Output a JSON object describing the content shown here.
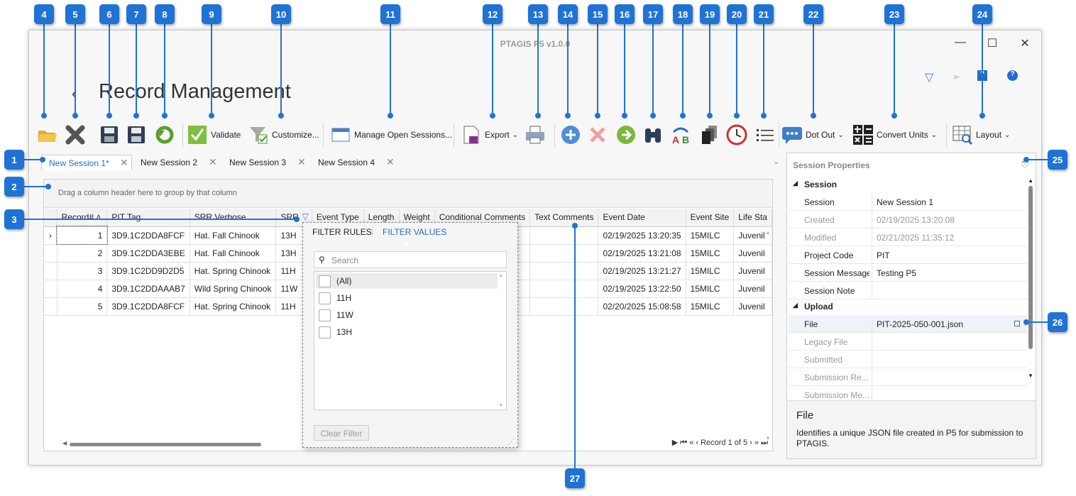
{
  "window": {
    "app_title": "PTAGIS P5 v1.0.0",
    "page_title": "Record Management",
    "min_icon": "minimize-icon",
    "max_icon": "maximize-icon",
    "close_icon": "close-icon"
  },
  "callouts": [
    "1",
    "2",
    "3",
    "4",
    "5",
    "6",
    "7",
    "8",
    "9",
    "10",
    "11",
    "12",
    "13",
    "14",
    "15",
    "16",
    "17",
    "18",
    "19",
    "20",
    "21",
    "22",
    "23",
    "24",
    "25",
    "26",
    "27"
  ],
  "toolbar": {
    "validate": "Validate",
    "customize": "Customize...",
    "manage_sessions": "Manage Open Sessions...",
    "export": "Export",
    "dot_out": "Dot Out",
    "convert_units": "Convert Units",
    "layout": "Layout"
  },
  "tabs": [
    {
      "label": "New Session 1*",
      "active": true
    },
    {
      "label": "New Session 2",
      "active": false
    },
    {
      "label": "New Session 3",
      "active": false
    },
    {
      "label": "New Session 4",
      "active": false
    }
  ],
  "grid": {
    "group_hint": "Drag a column header here to group by that column",
    "columns": [
      "Record#",
      "PIT Tag",
      "SRR Verbose",
      "SRR",
      "Event Type",
      "Length",
      "Weight",
      "Conditional Comments",
      "Text Comments",
      "Event Date",
      "Event Site",
      "Life Sta"
    ],
    "rows": [
      {
        "record": "1",
        "pit": "3D9.1C2DDA8FCF",
        "srr_verbose": "Hat. Fall Chinook",
        "srr": "13H",
        "date": "02/19/2025 13:20:35",
        "site": "15MILC",
        "life": "Juvenil"
      },
      {
        "record": "2",
        "pit": "3D9.1C2DDA3EBE",
        "srr_verbose": "Hat. Fall Chinook",
        "srr": "13H",
        "date": "02/19/2025 13:21:08",
        "site": "15MILC",
        "life": "Juvenil"
      },
      {
        "record": "3",
        "pit": "3D9.1C2DD9D2D5",
        "srr_verbose": "Hat. Spring Chinook",
        "srr": "11H",
        "date": "02/19/2025 13:21:27",
        "site": "15MILC",
        "life": "Juvenil"
      },
      {
        "record": "4",
        "pit": "3D9.1C2DDAAAB7",
        "srr_verbose": "Wild Spring Chinook",
        "srr": "11W",
        "date": "02/19/2025 13:22:50",
        "site": "15MILC",
        "life": "Juvenil"
      },
      {
        "record": "5",
        "pit": "3D9.1C2DDA8FCF",
        "srr_verbose": "Hat. Spring Chinook",
        "srr": "11H",
        "date": "02/20/2025 15:08:58",
        "site": "15MILC",
        "life": "Juvenil"
      }
    ],
    "pager": "Record 1 of 5"
  },
  "filter": {
    "tab_rules": "FILTER RULES",
    "tab_values": "FILTER VALUES",
    "search_placeholder": "Search",
    "values": [
      "(All)",
      "11H",
      "11W",
      "13H"
    ],
    "clear": "Clear Filter"
  },
  "properties": {
    "title": "Session Properties",
    "session_group": "Session",
    "session_rows": [
      {
        "key": "Session",
        "value": "New Session 1",
        "muted": false
      },
      {
        "key": "Created",
        "value": "02/19/2025 13:20:08",
        "muted": true
      },
      {
        "key": "Modified",
        "value": "02/21/2025 11:35:12",
        "muted": true
      },
      {
        "key": "Project Code",
        "value": "PIT",
        "muted": false
      },
      {
        "key": "Session Message",
        "value": "Testing P5",
        "muted": false
      },
      {
        "key": "Session Note",
        "value": "",
        "muted": false
      }
    ],
    "upload_group": "Upload",
    "upload_rows": [
      {
        "key": "File",
        "value": "PIT-2025-050-001.json",
        "muted": false
      },
      {
        "key": "Legacy File",
        "value": "",
        "muted": true
      },
      {
        "key": "Submitted",
        "value": "",
        "muted": true
      },
      {
        "key": "Submission Re...",
        "value": "",
        "muted": true
      },
      {
        "key": "Submission Me...",
        "value": "",
        "muted": true
      }
    ],
    "desc_title": "File",
    "desc_text": "Identifies a unique JSON file created in P5 for submission to PTAGIS."
  },
  "colors": {
    "accent": "#1f73d4",
    "link": "#1f6fcf"
  }
}
